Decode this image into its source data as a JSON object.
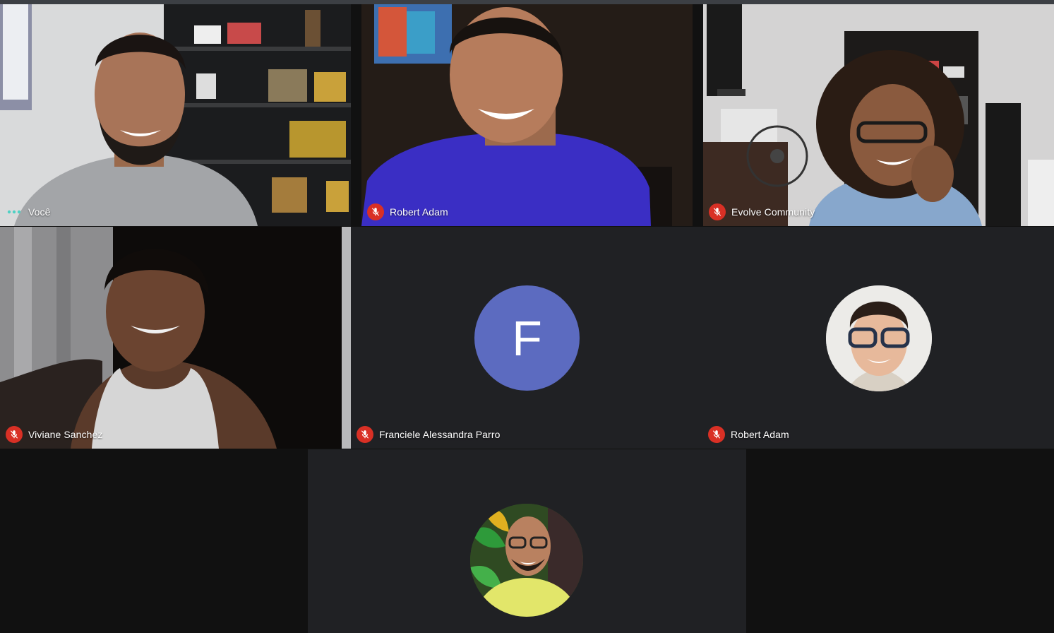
{
  "meeting": {
    "participants": [
      {
        "name": "Você",
        "status": "speaking-dots-icon"
      },
      {
        "name": "Robert Adam",
        "status": "mic-off-icon"
      },
      {
        "name": "Evolve Community",
        "status": "mic-off-icon"
      },
      {
        "name": "Viviane Sanchez",
        "status": "mic-off-icon"
      },
      {
        "name": "Franciele Alessandra Parro",
        "status": "mic-off-icon",
        "initial": "F",
        "avatar_color": "#5c6bc0"
      },
      {
        "name": "Robert Adam",
        "status": "mic-off-icon",
        "avatar": "profile-photo"
      },
      {
        "avatar": "profile-photo"
      }
    ]
  },
  "colors": {
    "tile_background": "#202124",
    "page_background": "#111111",
    "mic_off": "#d93025",
    "speaking_dots": "#4ed1c4"
  }
}
